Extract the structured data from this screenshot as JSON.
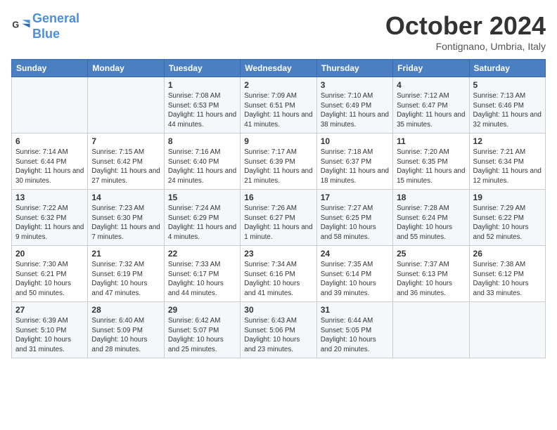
{
  "logo": {
    "line1": "General",
    "line2": "Blue"
  },
  "title": "October 2024",
  "subtitle": "Fontignano, Umbria, Italy",
  "headers": [
    "Sunday",
    "Monday",
    "Tuesday",
    "Wednesday",
    "Thursday",
    "Friday",
    "Saturday"
  ],
  "weeks": [
    [
      {
        "day": "",
        "info": ""
      },
      {
        "day": "",
        "info": ""
      },
      {
        "day": "1",
        "info": "Sunrise: 7:08 AM\nSunset: 6:53 PM\nDaylight: 11 hours and 44 minutes."
      },
      {
        "day": "2",
        "info": "Sunrise: 7:09 AM\nSunset: 6:51 PM\nDaylight: 11 hours and 41 minutes."
      },
      {
        "day": "3",
        "info": "Sunrise: 7:10 AM\nSunset: 6:49 PM\nDaylight: 11 hours and 38 minutes."
      },
      {
        "day": "4",
        "info": "Sunrise: 7:12 AM\nSunset: 6:47 PM\nDaylight: 11 hours and 35 minutes."
      },
      {
        "day": "5",
        "info": "Sunrise: 7:13 AM\nSunset: 6:46 PM\nDaylight: 11 hours and 32 minutes."
      }
    ],
    [
      {
        "day": "6",
        "info": "Sunrise: 7:14 AM\nSunset: 6:44 PM\nDaylight: 11 hours and 30 minutes."
      },
      {
        "day": "7",
        "info": "Sunrise: 7:15 AM\nSunset: 6:42 PM\nDaylight: 11 hours and 27 minutes."
      },
      {
        "day": "8",
        "info": "Sunrise: 7:16 AM\nSunset: 6:40 PM\nDaylight: 11 hours and 24 minutes."
      },
      {
        "day": "9",
        "info": "Sunrise: 7:17 AM\nSunset: 6:39 PM\nDaylight: 11 hours and 21 minutes."
      },
      {
        "day": "10",
        "info": "Sunrise: 7:18 AM\nSunset: 6:37 PM\nDaylight: 11 hours and 18 minutes."
      },
      {
        "day": "11",
        "info": "Sunrise: 7:20 AM\nSunset: 6:35 PM\nDaylight: 11 hours and 15 minutes."
      },
      {
        "day": "12",
        "info": "Sunrise: 7:21 AM\nSunset: 6:34 PM\nDaylight: 11 hours and 12 minutes."
      }
    ],
    [
      {
        "day": "13",
        "info": "Sunrise: 7:22 AM\nSunset: 6:32 PM\nDaylight: 11 hours and 9 minutes."
      },
      {
        "day": "14",
        "info": "Sunrise: 7:23 AM\nSunset: 6:30 PM\nDaylight: 11 hours and 7 minutes."
      },
      {
        "day": "15",
        "info": "Sunrise: 7:24 AM\nSunset: 6:29 PM\nDaylight: 11 hours and 4 minutes."
      },
      {
        "day": "16",
        "info": "Sunrise: 7:26 AM\nSunset: 6:27 PM\nDaylight: 11 hours and 1 minute."
      },
      {
        "day": "17",
        "info": "Sunrise: 7:27 AM\nSunset: 6:25 PM\nDaylight: 10 hours and 58 minutes."
      },
      {
        "day": "18",
        "info": "Sunrise: 7:28 AM\nSunset: 6:24 PM\nDaylight: 10 hours and 55 minutes."
      },
      {
        "day": "19",
        "info": "Sunrise: 7:29 AM\nSunset: 6:22 PM\nDaylight: 10 hours and 52 minutes."
      }
    ],
    [
      {
        "day": "20",
        "info": "Sunrise: 7:30 AM\nSunset: 6:21 PM\nDaylight: 10 hours and 50 minutes."
      },
      {
        "day": "21",
        "info": "Sunrise: 7:32 AM\nSunset: 6:19 PM\nDaylight: 10 hours and 47 minutes."
      },
      {
        "day": "22",
        "info": "Sunrise: 7:33 AM\nSunset: 6:17 PM\nDaylight: 10 hours and 44 minutes."
      },
      {
        "day": "23",
        "info": "Sunrise: 7:34 AM\nSunset: 6:16 PM\nDaylight: 10 hours and 41 minutes."
      },
      {
        "day": "24",
        "info": "Sunrise: 7:35 AM\nSunset: 6:14 PM\nDaylight: 10 hours and 39 minutes."
      },
      {
        "day": "25",
        "info": "Sunrise: 7:37 AM\nSunset: 6:13 PM\nDaylight: 10 hours and 36 minutes."
      },
      {
        "day": "26",
        "info": "Sunrise: 7:38 AM\nSunset: 6:12 PM\nDaylight: 10 hours and 33 minutes."
      }
    ],
    [
      {
        "day": "27",
        "info": "Sunrise: 6:39 AM\nSunset: 5:10 PM\nDaylight: 10 hours and 31 minutes."
      },
      {
        "day": "28",
        "info": "Sunrise: 6:40 AM\nSunset: 5:09 PM\nDaylight: 10 hours and 28 minutes."
      },
      {
        "day": "29",
        "info": "Sunrise: 6:42 AM\nSunset: 5:07 PM\nDaylight: 10 hours and 25 minutes."
      },
      {
        "day": "30",
        "info": "Sunrise: 6:43 AM\nSunset: 5:06 PM\nDaylight: 10 hours and 23 minutes."
      },
      {
        "day": "31",
        "info": "Sunrise: 6:44 AM\nSunset: 5:05 PM\nDaylight: 10 hours and 20 minutes."
      },
      {
        "day": "",
        "info": ""
      },
      {
        "day": "",
        "info": ""
      }
    ]
  ]
}
